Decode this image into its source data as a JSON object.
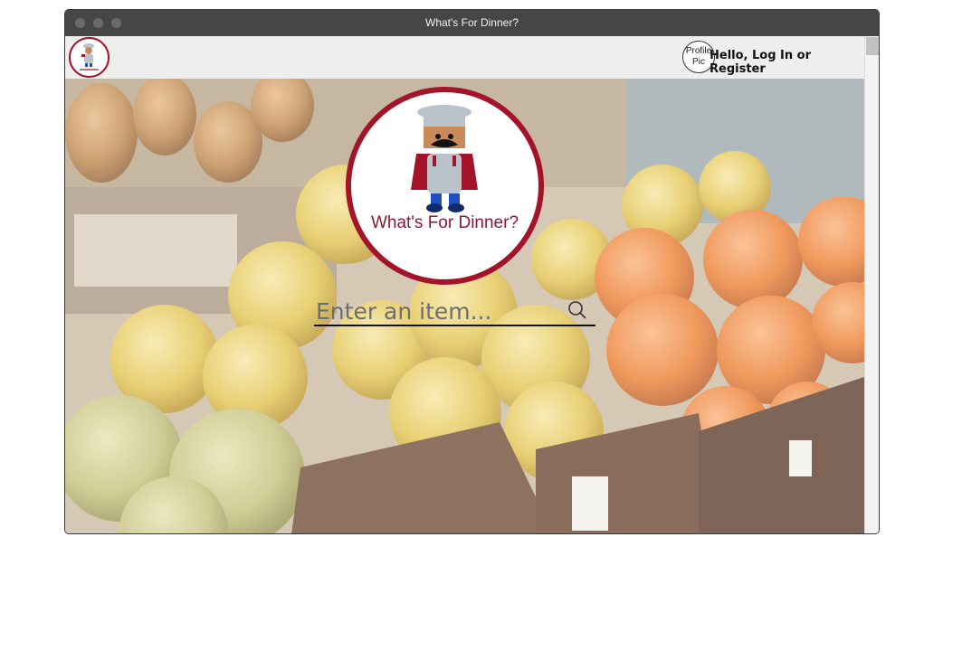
{
  "window": {
    "title": "What's For Dinner?"
  },
  "nav": {
    "profile_pic_label": "Profile Pic",
    "auth_link": "Hello, Log In or Register"
  },
  "logo": {
    "text": "What's For Dinner?"
  },
  "search": {
    "placeholder": "Enter an item..."
  },
  "colors": {
    "brand": "#a3132a",
    "titlebar": "#464646",
    "navbar": "#eeeeee"
  }
}
